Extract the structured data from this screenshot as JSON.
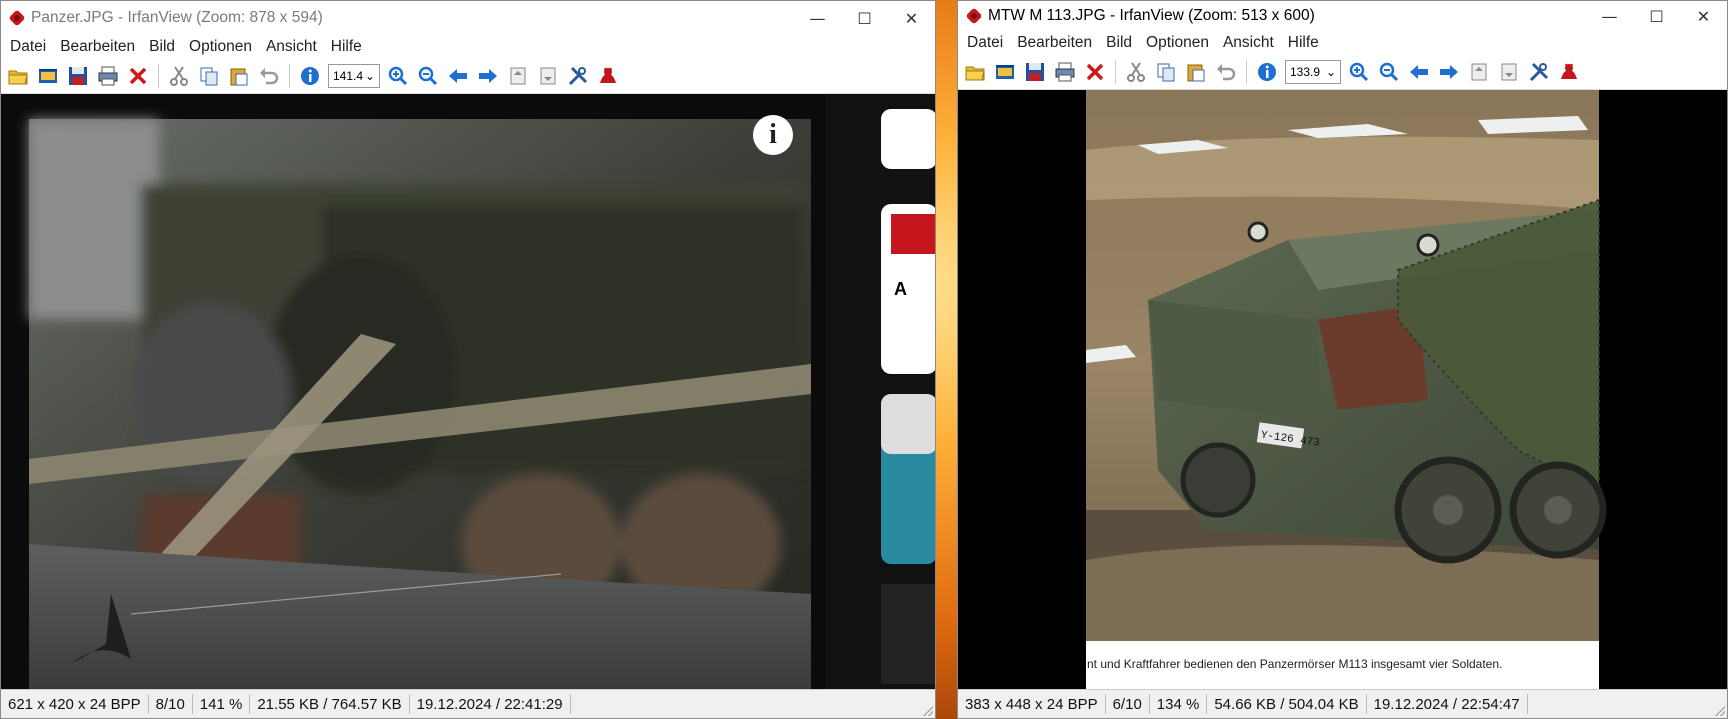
{
  "window1": {
    "title": "Panzer.JPG - IrfanView (Zoom: 878 x 594)",
    "menu": [
      "Datei",
      "Bearbeiten",
      "Bild",
      "Optionen",
      "Ansicht",
      "Hilfe"
    ],
    "zoom_value": "141.4",
    "status": [
      "621 x 420 x 24 BPP",
      "8/10",
      "141 %",
      "21.55 KB / 764.57 KB",
      "19.12.2024 / 22:41:29"
    ],
    "side_text": "A"
  },
  "window2": {
    "title": "MTW M 113.JPG - IrfanView (Zoom: 513 x 600)",
    "menu": [
      "Datei",
      "Bearbeiten",
      "Bild",
      "Optionen",
      "Ansicht",
      "Hilfe"
    ],
    "zoom_value": "133.9",
    "caption": "nt und Kraftfahrer bedienen den Panzermörser M113 insgesamt vier Soldaten.",
    "plate": "Y-126 473",
    "status": [
      "383 x 448 x 24 BPP",
      "6/10",
      "134 %",
      "54.66 KB / 504.04 KB",
      "19.12.2024 / 22:54:47"
    ]
  },
  "window_controls": {
    "minimize": "—",
    "maximize": "☐",
    "close": "✕"
  },
  "toolbar_icons": [
    "open-folder-icon",
    "thumbnails-icon",
    "save-icon",
    "print-icon",
    "delete-icon",
    "cut-icon",
    "copy-icon",
    "paste-icon",
    "undo-icon",
    "info-icon",
    "zoom-in-icon",
    "zoom-out-icon",
    "previous-icon",
    "next-icon",
    "first-page-icon",
    "last-page-icon",
    "settings-icon",
    "irfanview-cat-icon"
  ],
  "colors": {
    "title_inactive": "#7a7a7a",
    "accent_red": "#c4161c",
    "toolbar_blue": "#1e6fd0"
  }
}
